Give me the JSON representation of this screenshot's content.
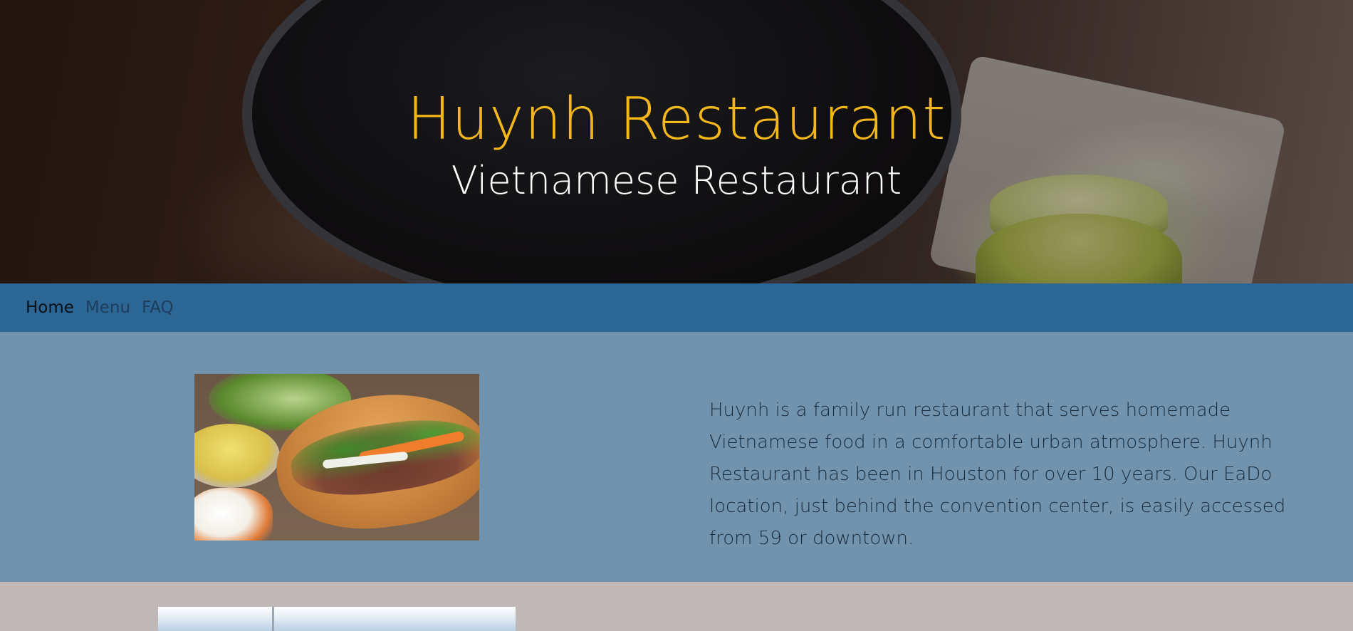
{
  "header": {
    "title": "Huynh Restaurant",
    "subtitle": "Vietnamese Restaurant"
  },
  "nav": {
    "items": [
      {
        "label": "Home",
        "active": true
      },
      {
        "label": "Menu",
        "active": false
      },
      {
        "label": "FAQ",
        "active": false
      }
    ]
  },
  "about": {
    "text": "Huynh is a family run restaurant that serves homemade Vietnamese food in a comfortable urban atmosphere. Huynh Restaurant has been in Houston for over 10 years. Our EaDo location, just behind the convention center, is easily accessed from 59 or downtown."
  },
  "colors": {
    "title": "#f3b61b",
    "navbar": "#2b6695",
    "about_bg": "#7193ae",
    "gallery_bg": "#c0b8b6"
  }
}
